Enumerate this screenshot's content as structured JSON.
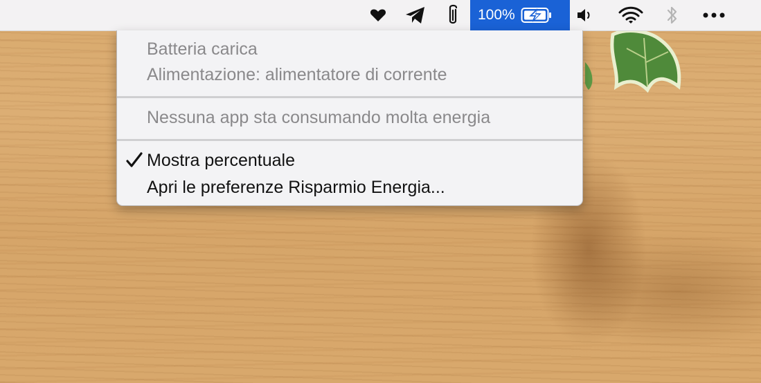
{
  "menubar": {
    "icons": [
      "heart-icon",
      "telegram-icon",
      "paperclip-icon",
      "volume-icon",
      "wifi-icon",
      "bluetooth-icon",
      "more-icon"
    ],
    "battery": {
      "percentage_label": "100%",
      "state": "charging",
      "level": 1.0
    },
    "accent_color": "#1a62d6"
  },
  "battery_menu": {
    "status": "Batteria carica",
    "power_source": "Alimentazione: alimentatore di corrente",
    "energy_usage": "Nessuna app sta consumando molta energia",
    "show_percentage": {
      "label": "Mostra percentuale",
      "checked": true
    },
    "open_preferences": "Apri le preferenze Risparmio Energia..."
  }
}
